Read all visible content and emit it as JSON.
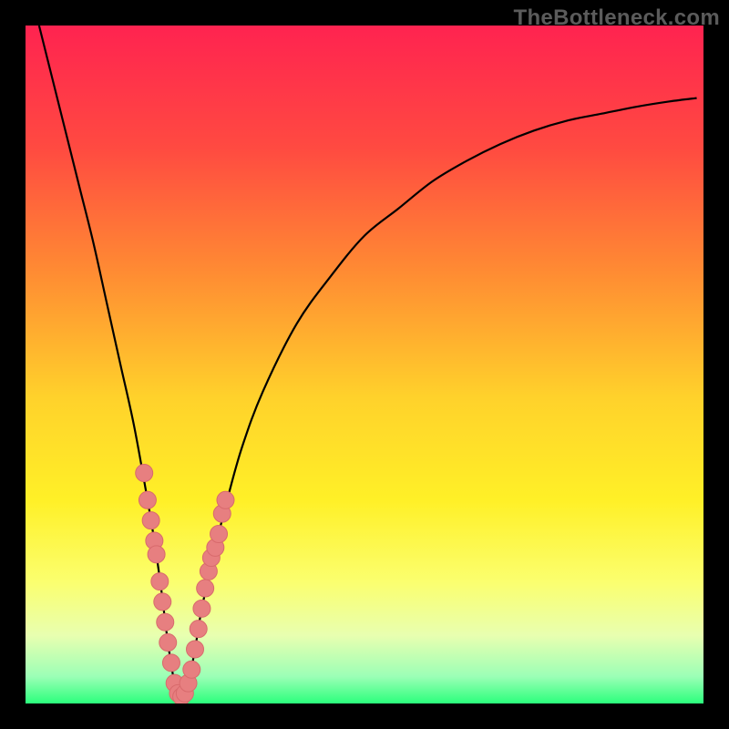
{
  "attribution": "TheBottleneck.com",
  "colors": {
    "frame": "#000000",
    "curve": "#000000",
    "dot_fill": "#e77f80",
    "dot_stroke": "#d86a6c",
    "gradient_stops": [
      {
        "offset": 0.0,
        "color": "#ff2350"
      },
      {
        "offset": 0.18,
        "color": "#ff4a41"
      },
      {
        "offset": 0.36,
        "color": "#ff8a33"
      },
      {
        "offset": 0.55,
        "color": "#ffd22b"
      },
      {
        "offset": 0.7,
        "color": "#fff027"
      },
      {
        "offset": 0.82,
        "color": "#fbff6e"
      },
      {
        "offset": 0.9,
        "color": "#e8ffb0"
      },
      {
        "offset": 0.96,
        "color": "#9cffb6"
      },
      {
        "offset": 1.0,
        "color": "#2bff7c"
      }
    ]
  },
  "chart_data": {
    "type": "line",
    "title": "",
    "xlabel": "",
    "ylabel": "",
    "xlim": [
      0,
      100
    ],
    "ylim": [
      0,
      100
    ],
    "series": [
      {
        "name": "bottleneck-curve",
        "x": [
          2,
          4,
          6,
          8,
          10,
          12,
          14,
          16,
          18,
          19,
          20,
          21,
          22,
          23,
          24,
          25,
          26,
          28,
          30,
          32,
          35,
          40,
          45,
          50,
          55,
          60,
          65,
          70,
          75,
          80,
          85,
          90,
          95,
          99
        ],
        "values": [
          100,
          92,
          84,
          76,
          68,
          59,
          50,
          41,
          30,
          24,
          17,
          9,
          3,
          1,
          3,
          8,
          14,
          23,
          31,
          38,
          46,
          56,
          63,
          69,
          73,
          77,
          80,
          82.5,
          84.5,
          86,
          87,
          88,
          88.8,
          89.3
        ]
      }
    ],
    "highlight_points": {
      "name": "sample-markers",
      "points": [
        {
          "x": 17.5,
          "y": 34
        },
        {
          "x": 18.0,
          "y": 30
        },
        {
          "x": 18.5,
          "y": 27
        },
        {
          "x": 19.0,
          "y": 24
        },
        {
          "x": 19.3,
          "y": 22
        },
        {
          "x": 19.8,
          "y": 18
        },
        {
          "x": 20.2,
          "y": 15
        },
        {
          "x": 20.6,
          "y": 12
        },
        {
          "x": 21.0,
          "y": 9
        },
        {
          "x": 21.5,
          "y": 6
        },
        {
          "x": 22.0,
          "y": 3
        },
        {
          "x": 22.5,
          "y": 1.5
        },
        {
          "x": 23.0,
          "y": 1
        },
        {
          "x": 23.5,
          "y": 1.5
        },
        {
          "x": 24.0,
          "y": 3
        },
        {
          "x": 24.5,
          "y": 5
        },
        {
          "x": 25.0,
          "y": 8
        },
        {
          "x": 25.5,
          "y": 11
        },
        {
          "x": 26.0,
          "y": 14
        },
        {
          "x": 26.5,
          "y": 17
        },
        {
          "x": 27.0,
          "y": 19.5
        },
        {
          "x": 27.4,
          "y": 21.5
        },
        {
          "x": 28.0,
          "y": 23
        },
        {
          "x": 28.5,
          "y": 25
        },
        {
          "x": 29.0,
          "y": 28
        },
        {
          "x": 29.5,
          "y": 30
        }
      ]
    }
  }
}
